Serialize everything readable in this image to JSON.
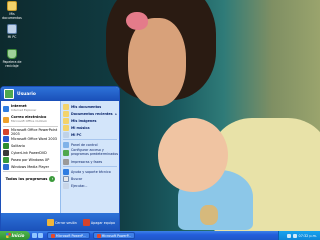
{
  "desktop": {
    "icons": [
      {
        "label": "Mis documentos",
        "icon": "my-documents-icon"
      },
      {
        "label": "Mi PC",
        "icon": "my-computer-icon"
      },
      {
        "label": "Papelera de reciclaje",
        "icon": "recycle-bin-icon"
      }
    ]
  },
  "start_menu": {
    "user": "Usuario",
    "pinned": [
      {
        "label": "Internet",
        "sub": "Internet Explorer",
        "icon": "internet-explorer-icon",
        "color": "#2f7de1"
      },
      {
        "label": "Correo electrónico",
        "sub": "Microsoft Office Outlook",
        "icon": "outlook-icon",
        "color": "#f0a12a"
      }
    ],
    "recent": [
      {
        "label": "Microsoft Office PowerPoint 2003",
        "icon": "powerpoint-icon",
        "color": "#d5432c"
      },
      {
        "label": "Microsoft Office Word 2003",
        "icon": "word-icon",
        "color": "#2a5bd0"
      },
      {
        "label": "Solitario",
        "icon": "solitaire-icon",
        "color": "#2f8f2f"
      },
      {
        "label": "CyberLink PowerDVD",
        "icon": "powerdvd-icon",
        "color": "#3a3a3a"
      },
      {
        "label": "Paseo por Windows XP",
        "icon": "tour-icon",
        "color": "#3a9a3a"
      },
      {
        "label": "Windows Media Player",
        "icon": "media-player-icon",
        "color": "#2f6fd0"
      }
    ],
    "all_programs": "Todos los programas",
    "right_top": [
      {
        "label": "Mis documentos",
        "icon": "documents-folder-icon",
        "color": "#f3d36b"
      },
      {
        "label": "Documentos recientes",
        "icon": "recent-docs-icon",
        "color": "#f3d36b",
        "has_arrow": true
      },
      {
        "label": "Mis imágenes",
        "icon": "pictures-folder-icon",
        "color": "#f3d36b"
      },
      {
        "label": "Mi música",
        "icon": "music-folder-icon",
        "color": "#f3d36b"
      },
      {
        "label": "Mi PC",
        "icon": "my-computer-icon",
        "color": "#bfd2e8"
      }
    ],
    "right_mid": [
      {
        "label": "Panel de control",
        "icon": "control-panel-icon",
        "color": "#7fb2e8"
      },
      {
        "label": "Configurar acceso y programas predeterminados",
        "icon": "defaults-icon",
        "color": "#4fa84f"
      },
      {
        "label": "Impresoras y faxes",
        "icon": "printer-icon",
        "color": "#9a9a9a"
      }
    ],
    "right_bottom": [
      {
        "label": "Ayuda y soporte técnico",
        "icon": "help-icon",
        "color": "#2f7de1"
      },
      {
        "label": "Buscar",
        "icon": "search-icon",
        "color": "#e8e8e8"
      },
      {
        "label": "Ejecutar...",
        "icon": "run-icon",
        "color": "#c9d6e8"
      }
    ],
    "logoff": "Cerrar sesión",
    "shutdown": "Apagar equipo"
  },
  "taskbar": {
    "start_label": "Inicio",
    "tasks": [
      {
        "label": "Microsoft PowerP...",
        "icon": "powerpoint-icon"
      },
      {
        "label": "Microsoft PowerP...",
        "icon": "powerpoint-icon"
      }
    ],
    "time": "07:32 p.m."
  }
}
